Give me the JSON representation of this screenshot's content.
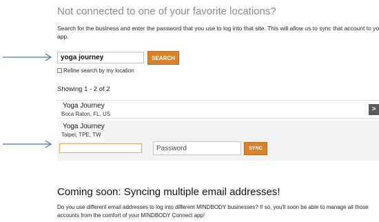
{
  "connect": {
    "heading": "Not connected to one of your favorite locations?",
    "intro_line1": "Search for the business and enter the password that you use to log into that site. This will allow us to sync that account to your Conne",
    "intro_line2": "app."
  },
  "search": {
    "value": "yoga journey",
    "button_label": "SEARCH",
    "refine_label": "Refine search by my location",
    "refine_checked": false
  },
  "results": {
    "showing": "Showing 1 - 2 of 2",
    "items": [
      {
        "name": "Yoga Journey",
        "location": "Boca Raton, FL, US",
        "action_icon": "chevron-right-icon",
        "action_label": ">"
      },
      {
        "name": "Yoga Journey",
        "location": "Taipei, TPE, TW"
      }
    ]
  },
  "sync_form": {
    "username_value": "",
    "password_placeholder": "Password",
    "sync_label": "SYNC"
  },
  "coming_soon": {
    "heading": "Coming soon: Syncing multiple email addresses!",
    "line1": "Do you use different email addresses to log into different MINDBODY businesses? If so, you'll soon be able to manage all those",
    "line2": "accounts from the comfort of your MINDBODY Connect app!"
  },
  "colors": {
    "accent_orange": "#d9822b",
    "annotation_arrow": "#4a6fa5",
    "muted_heading": "#8a8a8a"
  }
}
